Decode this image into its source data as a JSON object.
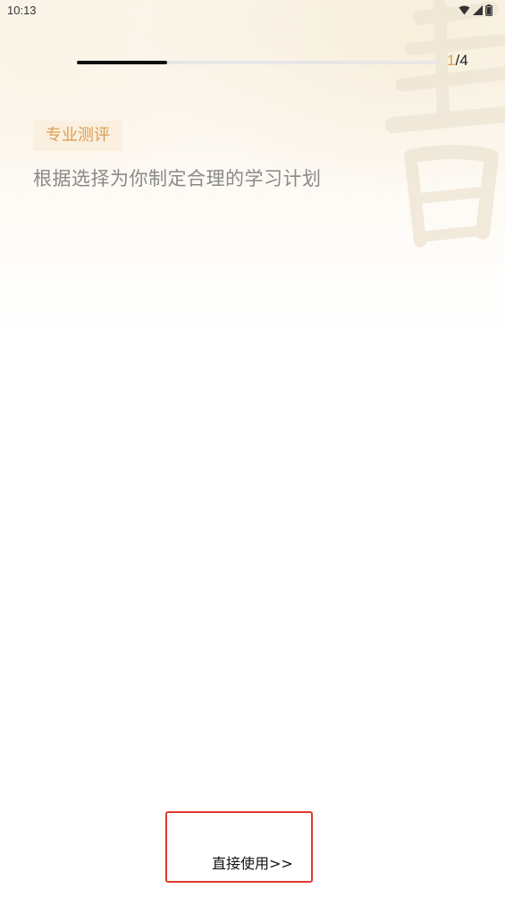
{
  "status_bar": {
    "time": "10:13",
    "icons": [
      "wifi-icon",
      "signal-icon",
      "battery-icon"
    ]
  },
  "onboarding": {
    "progress_fraction": 0.25,
    "page_current": "1",
    "page_separator_total": "/4",
    "tag": "专业测评",
    "subtitle": "根据选择为你制定合理的学习计划",
    "cta_label": "直接使用>>"
  },
  "colors": {
    "accent": "#D7A452",
    "tag_background": "#FBEFDF",
    "tag_text": "#DC9F52",
    "subtitle": "#8A8A8A",
    "progress_fill": "#111111",
    "progress_track": "#E7E7E7",
    "highlight_border": "#E03A2F"
  }
}
